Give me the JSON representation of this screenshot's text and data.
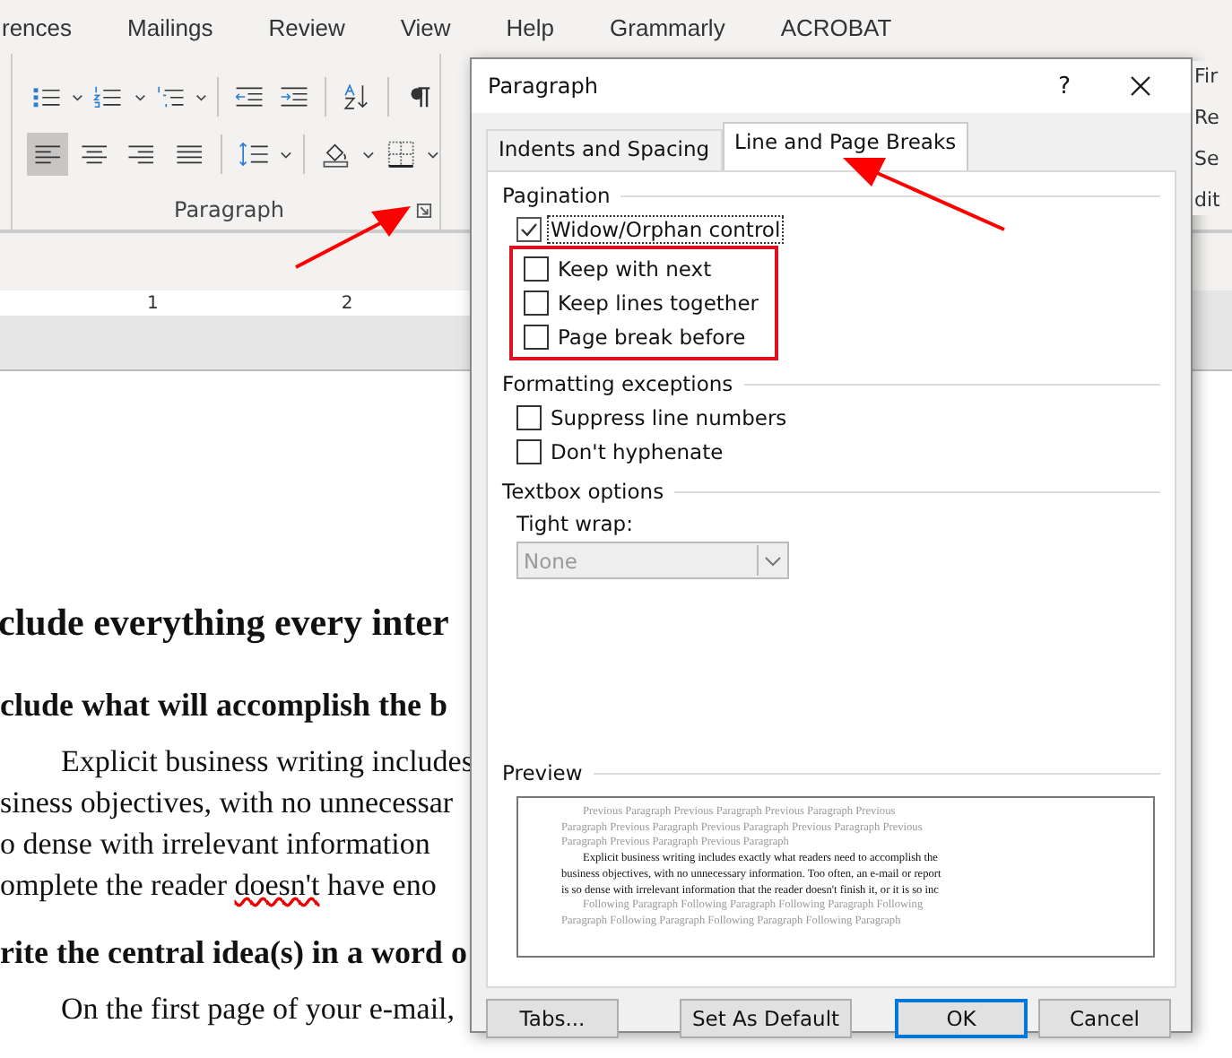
{
  "ribbon_tabs": [
    "rences",
    "Mailings",
    "Review",
    "View",
    "Help",
    "Grammarly",
    "ACROBAT"
  ],
  "ribbon": {
    "group_label": "Paragraph",
    "align_buttons": [
      {
        "selected": true
      },
      {
        "selected": false
      },
      {
        "selected": false
      },
      {
        "selected": false
      }
    ]
  },
  "right_pane": [
    "Fir",
    "Re",
    "Se",
    "dit"
  ],
  "ruler": {
    "marks": [
      "1",
      "2"
    ]
  },
  "document": [
    {
      "kind": "heading1",
      "text": "clude everything every inter"
    },
    {
      "kind": "heading2",
      "text": "clude what will accomplish the b"
    },
    {
      "kind": "body_first",
      "text": "Explicit business writing includes"
    },
    {
      "kind": "body",
      "text": "siness objectives, with no unnecessar"
    },
    {
      "kind": "body",
      "text": "o dense with irrelevant information"
    },
    {
      "kind": "body_spell",
      "text": "omplete the reader ",
      "misspelled": "doesn't",
      "rest": " have eno"
    },
    {
      "kind": "heading2",
      "text": "rite the central idea(s) in a word o"
    },
    {
      "kind": "body_first",
      "text": "On the first page of your e-mail,"
    }
  ],
  "dialog": {
    "title": "Paragraph",
    "help": "?",
    "tabs": [
      {
        "label": "Indents and Spacing",
        "selected": false
      },
      {
        "label": "Line and Page Breaks",
        "selected": true
      }
    ],
    "sections": [
      {
        "title": "Pagination",
        "options": [
          {
            "label": "Widow/Orphan control",
            "checked": true,
            "focused": true,
            "highlighted": false
          },
          {
            "label": "Keep with next",
            "checked": false,
            "focused": false,
            "highlighted": true
          },
          {
            "label": "Keep lines together",
            "checked": false,
            "focused": false,
            "highlighted": true
          },
          {
            "label": "Page break before",
            "checked": false,
            "focused": false,
            "highlighted": true
          }
        ]
      },
      {
        "title": "Formatting exceptions",
        "options": [
          {
            "label": "Suppress line numbers",
            "checked": false,
            "focused": false,
            "highlighted": false
          },
          {
            "label": "Don't hyphenate",
            "checked": false,
            "focused": false,
            "highlighted": false
          }
        ]
      },
      {
        "title": "Textbox options",
        "dropdown": {
          "label": "Tight wrap:",
          "value": "None",
          "disabled": true
        }
      }
    ],
    "preview": {
      "title": "Preview",
      "lines": [
        {
          "kind": "previous",
          "text": "Previous Paragraph Previous Paragraph Previous Paragraph Previous",
          "indent": true
        },
        {
          "kind": "previous",
          "text": "Paragraph Previous Paragraph Previous Paragraph Previous Paragraph Previous",
          "indent": false
        },
        {
          "kind": "previous",
          "text": "Paragraph Previous Paragraph Previous Paragraph",
          "indent": false
        },
        {
          "kind": "sample",
          "text": "Explicit business writing includes exactly what readers need to accomplish the",
          "indent": true
        },
        {
          "kind": "sample",
          "text": "business objectives, with no unnecessary information.  Too often, an e-mail or report",
          "indent": false
        },
        {
          "kind": "sample",
          "text": "is so dense with irrelevant information that the reader doesn't finish it, or it is so inc",
          "indent": false
        },
        {
          "kind": "following",
          "text": "Following Paragraph Following Paragraph Following Paragraph Following",
          "indent": true
        },
        {
          "kind": "following",
          "text": "Paragraph Following Paragraph Following Paragraph Following Paragraph",
          "indent": false
        }
      ]
    },
    "buttons": [
      {
        "label": "Tabs...",
        "default": false
      },
      {
        "label": "Set As Default",
        "default": false
      },
      {
        "label": "OK",
        "default": true
      },
      {
        "label": "Cancel",
        "default": false
      }
    ]
  }
}
